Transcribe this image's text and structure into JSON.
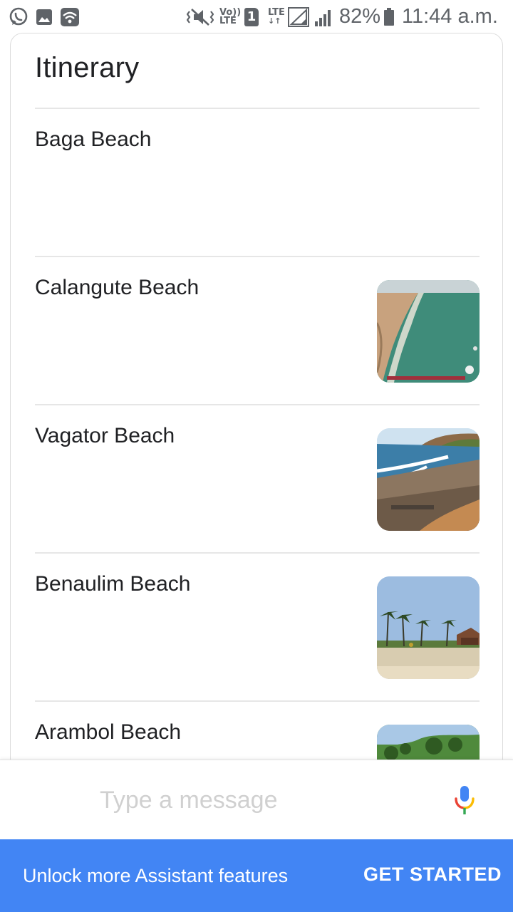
{
  "status_bar": {
    "left_icons": [
      "whatsapp-icon",
      "image-icon",
      "wifi-icon"
    ],
    "volte_label_top": "Vo))",
    "volte_label_bottom": "LTE",
    "sim_label": "1",
    "lte_label": "LTE",
    "battery_percent": "82%",
    "time": "11:44 a.m."
  },
  "card": {
    "title": "Itinerary",
    "items": [
      {
        "name": "Baga Beach",
        "has_image": false
      },
      {
        "name": "Calangute Beach",
        "has_image": true,
        "image": "aerial-beach-coastline"
      },
      {
        "name": "Vagator Beach",
        "has_image": true,
        "image": "beach-with-cliff"
      },
      {
        "name": "Benaulim Beach",
        "has_image": true,
        "image": "beach-with-palm-trees"
      },
      {
        "name": "Arambol Beach",
        "has_image": true,
        "image": "green-hill-trees"
      }
    ]
  },
  "message_bar": {
    "placeholder": "Type a message",
    "value": "",
    "mic_icon": "mic-icon"
  },
  "banner": {
    "text": "Unlock more Assistant features",
    "button_label": "GET STARTED",
    "background_color": "#4285f4"
  },
  "colors": {
    "google_blue": "#4285f4",
    "google_red": "#ea4335",
    "google_yellow": "#fbbc04",
    "google_green": "#34a853"
  }
}
